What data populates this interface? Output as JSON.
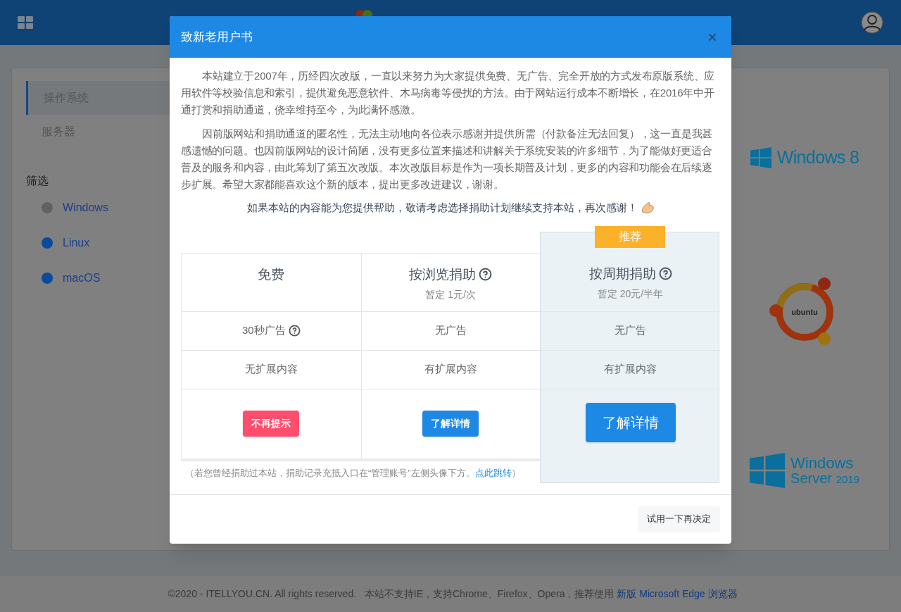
{
  "sidebar": {
    "items": [
      {
        "label": "操作系统",
        "selected": true
      },
      {
        "label": "服务器",
        "selected": false
      }
    ],
    "filter_title": "筛选",
    "filters": [
      {
        "label": "Windows",
        "color": "#5d6266"
      },
      {
        "label": "Linux",
        "color": "#0a4a9c"
      },
      {
        "label": "macOS",
        "color": "#0a4a9c"
      }
    ]
  },
  "os_logos": [
    {
      "kind": "win8",
      "label": "Windows 8"
    },
    {
      "kind": "ubuntu",
      "label": "ubuntu"
    },
    {
      "kind": "server",
      "label": "Windows",
      "sublabel": "Server",
      "year": "2019"
    }
  ],
  "footer": {
    "text": "©2020 - ITELLYOU.CN. All rights reserved.   本站不支持IE，支持Chrome、Firefox、Opera，推荐使用 ",
    "link": "新版 Microsoft Edge 浏览器"
  },
  "dialog": {
    "title": "致新老用户书",
    "close": "×",
    "paragraphs": [
      "本站建立于2007年，历经四次改版，一直以来努力为大家提供免费、无广告、完全开放的方式发布原版系统、应用软件等校验信息和索引，提供避免恶意软件、木马病毒等侵扰的方法。由于网站运行成本不断增长，在2016年中开通打赏和捐助通道，侥幸维持至今，为此满怀感激。",
      "因前版网站和捐助通道的匿名性，无法主动地向各位表示感谢并提供所需（付款备注无法回复），这一直是我甚感遗憾的问题。也因前版网站的设计简陋，没有更多位置来描述和讲解关于系统安装的许多细节，为了能做好更适合普及的服务和内容，由此筹划了第五次改版。本次改版目标是作为一项长期普及计划，更多的内容和功能会在后续逐步扩展。希望大家都能喜欢这个新的版本，提出更多改进建议，谢谢。"
    ],
    "appeal": "如果本站的内容能为您提供帮助，敬请考虑选择捐助计划继续支持本站，再次感谢！",
    "plans": [
      {
        "name": "免费",
        "name_help": false,
        "ad": "30秒广告",
        "ad_help": true,
        "extension": "无扩展内容",
        "button": {
          "label": "不再提示",
          "kind": "dismiss"
        },
        "highlighted": false
      },
      {
        "name": "按浏览捐助",
        "name_help": true,
        "price": "暂定 1元/次",
        "ad": "无广告",
        "ad_help": false,
        "extension": "有扩展内容",
        "button": {
          "label": "了解详情",
          "kind": "details"
        },
        "highlighted": false
      },
      {
        "name": "按周期捐助",
        "name_help": true,
        "price": "暂定 20元/半年",
        "ad": "无广告",
        "ad_help": false,
        "extension": "有扩展内容",
        "button": {
          "label": "了解详情",
          "kind": "details"
        },
        "highlighted": true,
        "badge": "推荐"
      }
    ],
    "note": {
      "before": "（若您曾经捐助过本站，捐助记录充抵入口在“管理账号”左侧头像下方。",
      "link": "点此跳转",
      "after": "）"
    },
    "try_button": "试用一下再决定"
  }
}
